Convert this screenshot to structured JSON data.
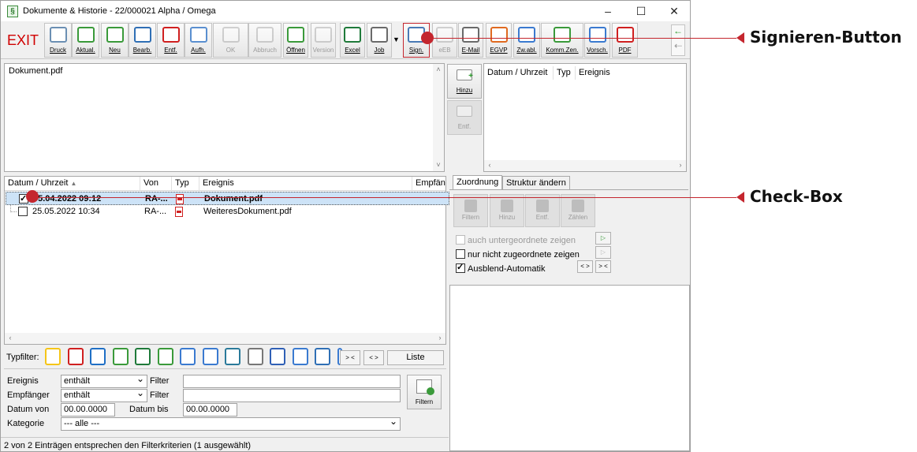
{
  "window": {
    "title": "Dokumente & Historie - 22/000021  Alpha / Omega",
    "minimize": "–",
    "maximize": "☐",
    "close": "✕"
  },
  "toolbar": {
    "exit": "EXIT",
    "buttons": [
      {
        "label": "Druck",
        "icon": "printer-icon",
        "color": "#6b8fb3"
      },
      {
        "label": "Aktual.",
        "icon": "refresh-icon",
        "color": "#3a9a3a"
      },
      {
        "label": "Neu",
        "icon": "plus-icon",
        "color": "#3a9a3a"
      },
      {
        "label": "Bearb.",
        "icon": "pencil-icon",
        "color": "#2f6fb5"
      },
      {
        "label": "Entf.",
        "icon": "delete-icon",
        "color": "#d02020"
      },
      {
        "label": "Aufh.",
        "icon": "hierarchy-icon",
        "color": "#5a8fd0"
      },
      {
        "label": "OK",
        "icon": "check-icon",
        "color": "#888888"
      },
      {
        "label": "Abbruch",
        "icon": "cancel-icon",
        "color": "#888888"
      },
      {
        "label": "Öffnen",
        "icon": "open-document-icon",
        "color": "#3a9a3a"
      },
      {
        "label": "Version",
        "icon": "version-icon",
        "color": "#888888"
      },
      {
        "label": "Excel",
        "icon": "excel-icon",
        "color": "#1f7a3a"
      },
      {
        "label": "Job",
        "icon": "job-icon",
        "color": "#6a6a6a"
      },
      {
        "label": "Sign.",
        "icon": "sign-icon",
        "color": "#4a7ab5"
      },
      {
        "label": "eEB",
        "icon": "eeb-icon",
        "color": "#888888"
      },
      {
        "label": "E-Mail",
        "icon": "email-icon",
        "color": "#6a6a6a"
      },
      {
        "label": "EGVP",
        "icon": "egvp-icon",
        "color": "#e06a20"
      },
      {
        "label": "Zw.abl.",
        "icon": "clipboard-icon",
        "color": "#3a7ad0"
      },
      {
        "label": "Komm.Zen.",
        "icon": "communication-icon",
        "color": "#3a9a3a"
      },
      {
        "label": "Vorsch.",
        "icon": "preview-icon",
        "color": "#3a7ad0"
      },
      {
        "label": "PDF",
        "icon": "pdf-icon",
        "color": "#d02020"
      }
    ]
  },
  "preview": {
    "filename": "Dokument.pdf"
  },
  "side_buttons": {
    "add": "Hinzu",
    "remove": "Entf."
  },
  "history": {
    "columns": [
      "Datum / Uhrzeit",
      "Typ",
      "Ereignis"
    ]
  },
  "documents": {
    "columns": [
      "Datum / Uhrzeit",
      "Von",
      "Typ",
      "Ereignis",
      "Empfän"
    ],
    "rows": [
      {
        "date": "05.04.2022  09:12",
        "from": "RA-...",
        "event": "Dokument.pdf",
        "checked": true,
        "selected": true
      },
      {
        "date": "25.05.2022  10:34",
        "from": "RA-...",
        "event": "WeiteresDokument.pdf",
        "checked": false,
        "selected": false
      }
    ]
  },
  "tabs": {
    "assignment": "Zuordnung",
    "structure": "Struktur ändern"
  },
  "assign_buttons": {
    "filter": "Filtern",
    "add": "Hinzu",
    "remove": "Entf.",
    "count": "Zählen"
  },
  "options": {
    "subordinate": "auch untergeordnete zeigen",
    "unassigned": "nur nicht zugeordnete zeigen",
    "autohide": "Ausblend-Automatik"
  },
  "typfilter": {
    "label": "Typfilter:",
    "btn1": "> <",
    "btn2": "< >",
    "list": "Liste"
  },
  "filters": {
    "ereignis": "Ereignis",
    "empfaenger": "Empfänger",
    "op": "enthält",
    "filter": "Filter",
    "datum_von": "Datum von",
    "datum_bis": "Datum bis",
    "date_value": "00.00.0000",
    "kategorie": "Kategorie",
    "kategorie_value": "--- alle ---",
    "filter_btn": "Filtern"
  },
  "status": "2 von 2 Einträgen entsprechen den Filterkriterien (1 ausgewählt)",
  "callouts": {
    "sign": "Signieren-Button",
    "checkbox": "Check-Box"
  },
  "colors": {
    "callout": "#c4262e",
    "selection": "#cde3f7",
    "exit": "#d00000"
  }
}
